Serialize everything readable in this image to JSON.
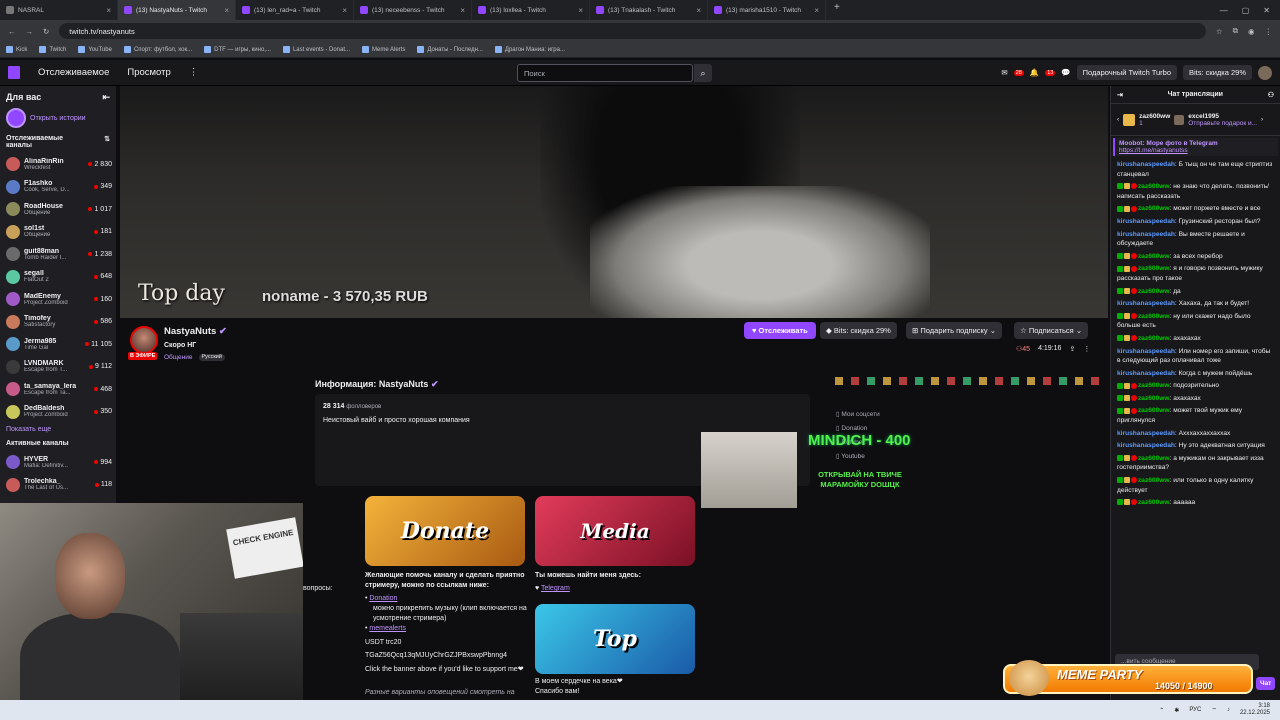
{
  "browser": {
    "tabs": [
      {
        "title": "NASRAL",
        "active": false
      },
      {
        "title": "(13) NastyaNuts - Twitch",
        "active": true
      },
      {
        "title": "(13) len_rad=a - Twitch",
        "active": false
      },
      {
        "title": "(13) neceebenss - Twitch",
        "active": false
      },
      {
        "title": "(13) loxllea - Twitch",
        "active": false
      },
      {
        "title": "(13) Tnakalash - Twitch",
        "active": false
      },
      {
        "title": "(13) marisha1510 - Twitch",
        "active": false
      }
    ],
    "url": "twitch.tv/nastyanuts",
    "bookmarks": [
      "Kick",
      "Twitch",
      "YouTube",
      "Спорт: футбол, хок...",
      "DTF — игры, кино,...",
      "Last events - Donat...",
      "Meme Alerts",
      "Донаты - Последн...",
      "Драгон Маниа: игра..."
    ]
  },
  "topnav": {
    "following": "Отслеживаемое",
    "browse": "Просмотр",
    "more": "⋮",
    "search_placeholder": "Поиск",
    "notif_badge_1": "28",
    "notif_badge_2": "13",
    "gift_turbo": "Подарочный Twitch Turbo",
    "bits_discount": "Bits: скидка 29%"
  },
  "sidebar": {
    "for_you": "Для вас",
    "open_stories": "Открыть истории",
    "followed_channels": "Отслеживаемые каналы",
    "channels": [
      {
        "name": "AlinaRinRin",
        "game": "Wreckfest",
        "viewers": "2 830",
        "color": "#c85a5a"
      },
      {
        "name": "F1ashko",
        "game": "Cook, Serve, D...",
        "viewers": "349",
        "color": "#5a7ac8"
      },
      {
        "name": "RoadHouse",
        "game": "Общение",
        "viewers": "1 017",
        "color": "#8a8a5a"
      },
      {
        "name": "sol1st",
        "game": "Общение",
        "viewers": "181",
        "color": "#c8a05a"
      },
      {
        "name": "guit88man",
        "game": "Tomb Raider I...",
        "viewers": "1 238",
        "color": "#6a6a6a"
      },
      {
        "name": "segall",
        "game": "FlatOut 2",
        "viewers": "648",
        "color": "#5ac8a0"
      },
      {
        "name": "MadEnemy",
        "game": "Project Zomboid",
        "viewers": "160",
        "color": "#a05ac8"
      },
      {
        "name": "Timofey",
        "game": "Satisfactory",
        "viewers": "586",
        "color": "#c87a5a"
      },
      {
        "name": "Jerma985",
        "game": "Time Gal",
        "viewers": "11 105",
        "color": "#5a9ac8"
      },
      {
        "name": "LVNDMARK",
        "game": "Escape from T...",
        "viewers": "9 112",
        "color": "#3a3a3a"
      },
      {
        "name": "ta_samaya_lera",
        "game": "Escape from Ta...",
        "viewers": "468",
        "color": "#c85a8a"
      },
      {
        "name": "DedBaldesh",
        "game": "Project Zomboid",
        "viewers": "350",
        "color": "#c8c85a"
      }
    ],
    "show_more": "Показать еще",
    "active_channels": "Активные каналы",
    "active": [
      {
        "name": "HYVER",
        "game": "Mafia: Definitiv...",
        "viewers": "994",
        "color": "#7a5ac8"
      },
      {
        "name": "Trolechka_",
        "game": "The Last of Us...",
        "viewers": "118",
        "color": "#c85a5a"
      }
    ]
  },
  "video": {
    "overlay_top": "Top day",
    "overlay_donation": "noname - 3 570,35 RUB"
  },
  "channel": {
    "name": "NastyaNuts",
    "title": "Скоро НГ",
    "category": "Общение",
    "tag": "Русский",
    "live_label": "В ЭФИРЕ",
    "follow": "Отслеживать",
    "bits": "Bits: скидка 29%",
    "gift_sub": "Подарить подписку",
    "subscribe": "Подписаться",
    "viewers": "45",
    "uptime": "4:19:16"
  },
  "about": {
    "heading": "Информация: NastyaNuts",
    "followers_count": "28 314",
    "followers_label": "фолловеров",
    "description": "Неистовый вайб и просто хорошая компания",
    "links": [
      "Мои соцсети",
      "Donation",
      "Rutube",
      "Youtube"
    ],
    "alert_title": "MINDICH - 400",
    "alert_sub": "ОТКРЫВАЙ НА ТВИЧЕ МАРАМОЙКУ DOШЦК",
    "panel_donate": "Donate",
    "panel_media": "Media",
    "panel_top": "Top",
    "partial_left": "вопросы:",
    "donate_text": "Желающие помочь каналу и сделать приятно стримеру, можно по ссылкам ниже:",
    "donate_link": "Donation",
    "donate_note": "можно прикрепить музыку (клип включается на усмотрение стримера)",
    "memealerts": "memealerts",
    "usdt": "USDT trc20",
    "wallet": "TGaZ56Qcq13qMJUyChrGZJPBxswpPbnng4",
    "click_banner": "Click the banner above if you'd like to support me❤",
    "various": "Разные варианты оповещений смотреть на",
    "media_text": "Ты можешь найти меня здесь:",
    "telegram": "Telegram",
    "top_text": "В моем сердечке на века❤ Спасибо вам!"
  },
  "webcam": {
    "sign": "CHECK ENGINE"
  },
  "chat": {
    "header": "Чат трансляции",
    "gift1_user": "zaz600ww",
    "gift1_count": "1",
    "gift2_user": "excel1995",
    "gift2_text": "Отправьте подарок и...",
    "pinned": "Moobot: Море фото в Telegram",
    "pinned_link": "https://t.me/nastyanutss",
    "messages": [
      {
        "user": "kirushanaspeedah",
        "text": "Б тыщ он че там еще стриптиз станцевал",
        "color": "#5b99ff",
        "badges": 0
      },
      {
        "user": "zaz600ww",
        "text": "не знаю что делать. позвонить/написать рассказать",
        "color": "#00c800",
        "badges": 3
      },
      {
        "user": "zaz600ww",
        "text": "может поржете вместе и все",
        "color": "#00c800",
        "badges": 3
      },
      {
        "user": "kirushanaspeedah",
        "text": "Грузинский ресторан был?",
        "color": "#5b99ff",
        "badges": 0
      },
      {
        "user": "kirushanaspeedah",
        "text": "Вы вместе решаете и обсуждаете",
        "color": "#5b99ff",
        "badges": 0
      },
      {
        "user": "zaz600ww",
        "text": "за всех перебор",
        "color": "#00c800",
        "badges": 3
      },
      {
        "user": "zaz600ww",
        "text": "я и говорю позвонить мужику рассказать про такое",
        "color": "#00c800",
        "badges": 3
      },
      {
        "user": "zaz600ww",
        "text": "да",
        "color": "#00c800",
        "badges": 3
      },
      {
        "user": "kirushanaspeedah",
        "text": "Хахаха, да так и будет!",
        "color": "#5b99ff",
        "badges": 0
      },
      {
        "user": "zaz600ww",
        "text": "ну или скажет надо было больше есть",
        "color": "#00c800",
        "badges": 3
      },
      {
        "user": "zaz600ww",
        "text": "ахахахах",
        "color": "#00c800",
        "badges": 3
      },
      {
        "user": "kirushanaspeedah",
        "text": "Или номер его запиши, чтобы в следующий раз оплачивал тоже",
        "color": "#5b99ff",
        "badges": 0
      },
      {
        "user": "kirushanaspeedah",
        "text": "Когда с мужем пойдёшь",
        "color": "#5b99ff",
        "badges": 0
      },
      {
        "user": "zaz600ww",
        "text": "подозрительно",
        "color": "#00c800",
        "badges": 3
      },
      {
        "user": "zaz600ww",
        "text": "ахахахах",
        "color": "#00c800",
        "badges": 3
      },
      {
        "user": "zaz600ww",
        "text": "может твой мужик ему приглянулся",
        "color": "#00c800",
        "badges": 3
      },
      {
        "user": "kirushanaspeedah",
        "text": "Ахххаххаххаххах",
        "color": "#5b99ff",
        "badges": 0
      },
      {
        "user": "kirushanaspeedah",
        "text": "Ну это адекватная ситуация",
        "color": "#5b99ff",
        "badges": 0
      },
      {
        "user": "zaz600ww",
        "text": "а мужикам он закрывает изза гостеприимства?",
        "color": "#00c800",
        "badges": 3
      },
      {
        "user": "zaz600ww",
        "text": "или только в одну калитку действует",
        "color": "#00c800",
        "badges": 3
      },
      {
        "user": "zaz600ww",
        "text": "аааааа",
        "color": "#00c800",
        "badges": 3
      }
    ],
    "input_placeholder": "...вить сообщение",
    "send": "Чат"
  },
  "meme_party": {
    "title": "MEME PARTY",
    "counter": "14050 / 14900"
  },
  "taskbar": {
    "lang": "РУС",
    "time": "3:18",
    "date": "22.12.2025"
  }
}
